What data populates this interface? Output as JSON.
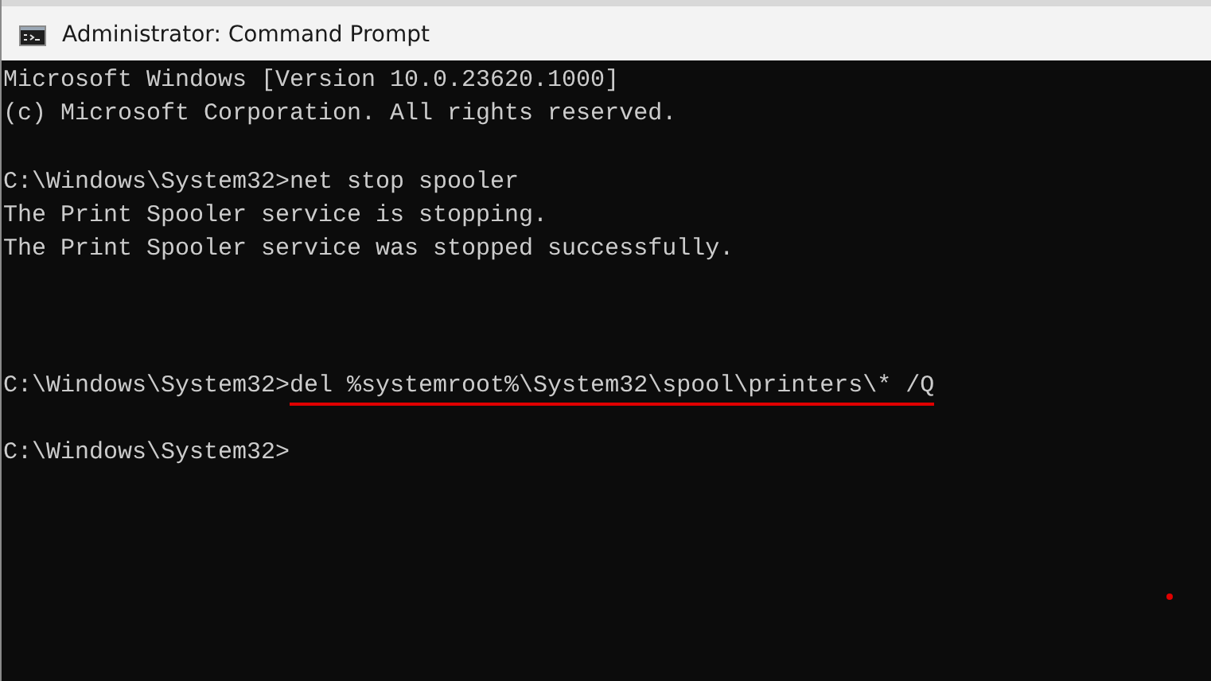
{
  "window": {
    "title": "Administrator: Command Prompt"
  },
  "console": [
    {
      "kind": "output",
      "text": "Microsoft Windows [Version 10.0.23620.1000]"
    },
    {
      "kind": "output",
      "text": "(c) Microsoft Corporation. All rights reserved."
    },
    {
      "kind": "blank"
    },
    {
      "kind": "command",
      "prompt": "C:\\Windows\\System32>",
      "command": "net stop spooler",
      "underlined": false
    },
    {
      "kind": "output",
      "text": "The Print Spooler service is stopping."
    },
    {
      "kind": "output",
      "text": "The Print Spooler service was stopped successfully."
    },
    {
      "kind": "blank"
    },
    {
      "kind": "blank"
    },
    {
      "kind": "blank"
    },
    {
      "kind": "command",
      "prompt": "C:\\Windows\\System32>",
      "command": "del %systemroot%\\System32\\spool\\printers\\* /Q",
      "underlined": true
    },
    {
      "kind": "blank"
    },
    {
      "kind": "command",
      "prompt": "C:\\Windows\\System32>"
    }
  ]
}
